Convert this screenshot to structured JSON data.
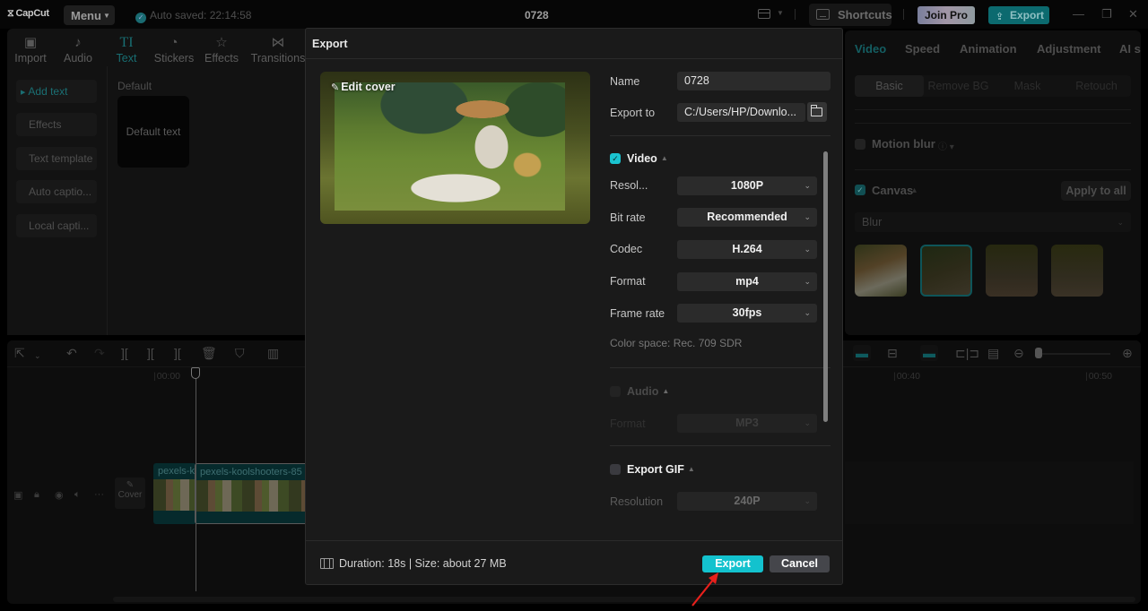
{
  "app": {
    "logo": "CapCut",
    "menu_label": "Menu",
    "autosave": "Auto saved: 22:14:58",
    "project_title": "0728",
    "shortcuts_label": "Shortcuts",
    "join_pro_label": "Join Pro",
    "export_label": "Export"
  },
  "toolbar_tabs": [
    {
      "label": "Import",
      "icon": "import-icon",
      "glyph": "▣"
    },
    {
      "label": "Audio",
      "icon": "audio-icon",
      "glyph": "♪"
    },
    {
      "label": "Text",
      "icon": "text-icon",
      "glyph": "TI",
      "active": true
    },
    {
      "label": "Stickers",
      "icon": "sticker-icon",
      "glyph": "◔"
    },
    {
      "label": "Effects",
      "icon": "effects-icon",
      "glyph": "☆"
    },
    {
      "label": "Transitions",
      "icon": "transitions-icon",
      "glyph": "⋈"
    }
  ],
  "text_panel": {
    "items": [
      "Add text",
      "Effects",
      "Text template",
      "Auto captio...",
      "Local capti..."
    ],
    "active_item": "Add text",
    "section_label": "Default",
    "card_label": "Default text"
  },
  "inspector": {
    "tabs": [
      "Video",
      "Speed",
      "Animation",
      "Adjustment",
      "AI st"
    ],
    "active_tab": "Video",
    "subtabs": [
      "Basic",
      "Remove BG",
      "Mask",
      "Retouch"
    ],
    "active_subtab": "Basic",
    "motion_blur": {
      "label": "Motion blur",
      "checked": false
    },
    "canvas": {
      "label": "Canvas",
      "checked": true,
      "apply_all_label": "Apply to all",
      "mode": "Blur"
    }
  },
  "timeline": {
    "ruler": [
      "00:00",
      "00:40",
      "00:50"
    ],
    "cover_label": "Cover",
    "clips": [
      "pexels-k",
      "pexels-koolshooters-85"
    ]
  },
  "export_dialog": {
    "title": "Export",
    "edit_cover_label": "Edit cover",
    "name_label": "Name",
    "name_value": "0728",
    "export_to_label": "Export to",
    "export_to_value": "C:/Users/HP/Downlo...",
    "video": {
      "title": "Video",
      "checked": true,
      "fields": [
        {
          "label": "Resol...",
          "value": "1080P"
        },
        {
          "label": "Bit rate",
          "value": "Recommended"
        },
        {
          "label": "Codec",
          "value": "H.264"
        },
        {
          "label": "Format",
          "value": "mp4"
        },
        {
          "label": "Frame rate",
          "value": "30fps"
        }
      ],
      "color_space": "Color space: Rec. 709 SDR"
    },
    "audio": {
      "title": "Audio",
      "checked": false,
      "format_label": "Format",
      "format_value": "MP3"
    },
    "gif": {
      "title": "Export GIF",
      "checked": false,
      "resolution_label": "Resolution",
      "resolution_value": "240P"
    },
    "footer_info": "Duration: 18s | Size: about 27 MB",
    "export_button": "Export",
    "cancel_button": "Cancel"
  },
  "colors": {
    "accent": "#13c2ce",
    "annotation_arrow": "#e8201c"
  }
}
